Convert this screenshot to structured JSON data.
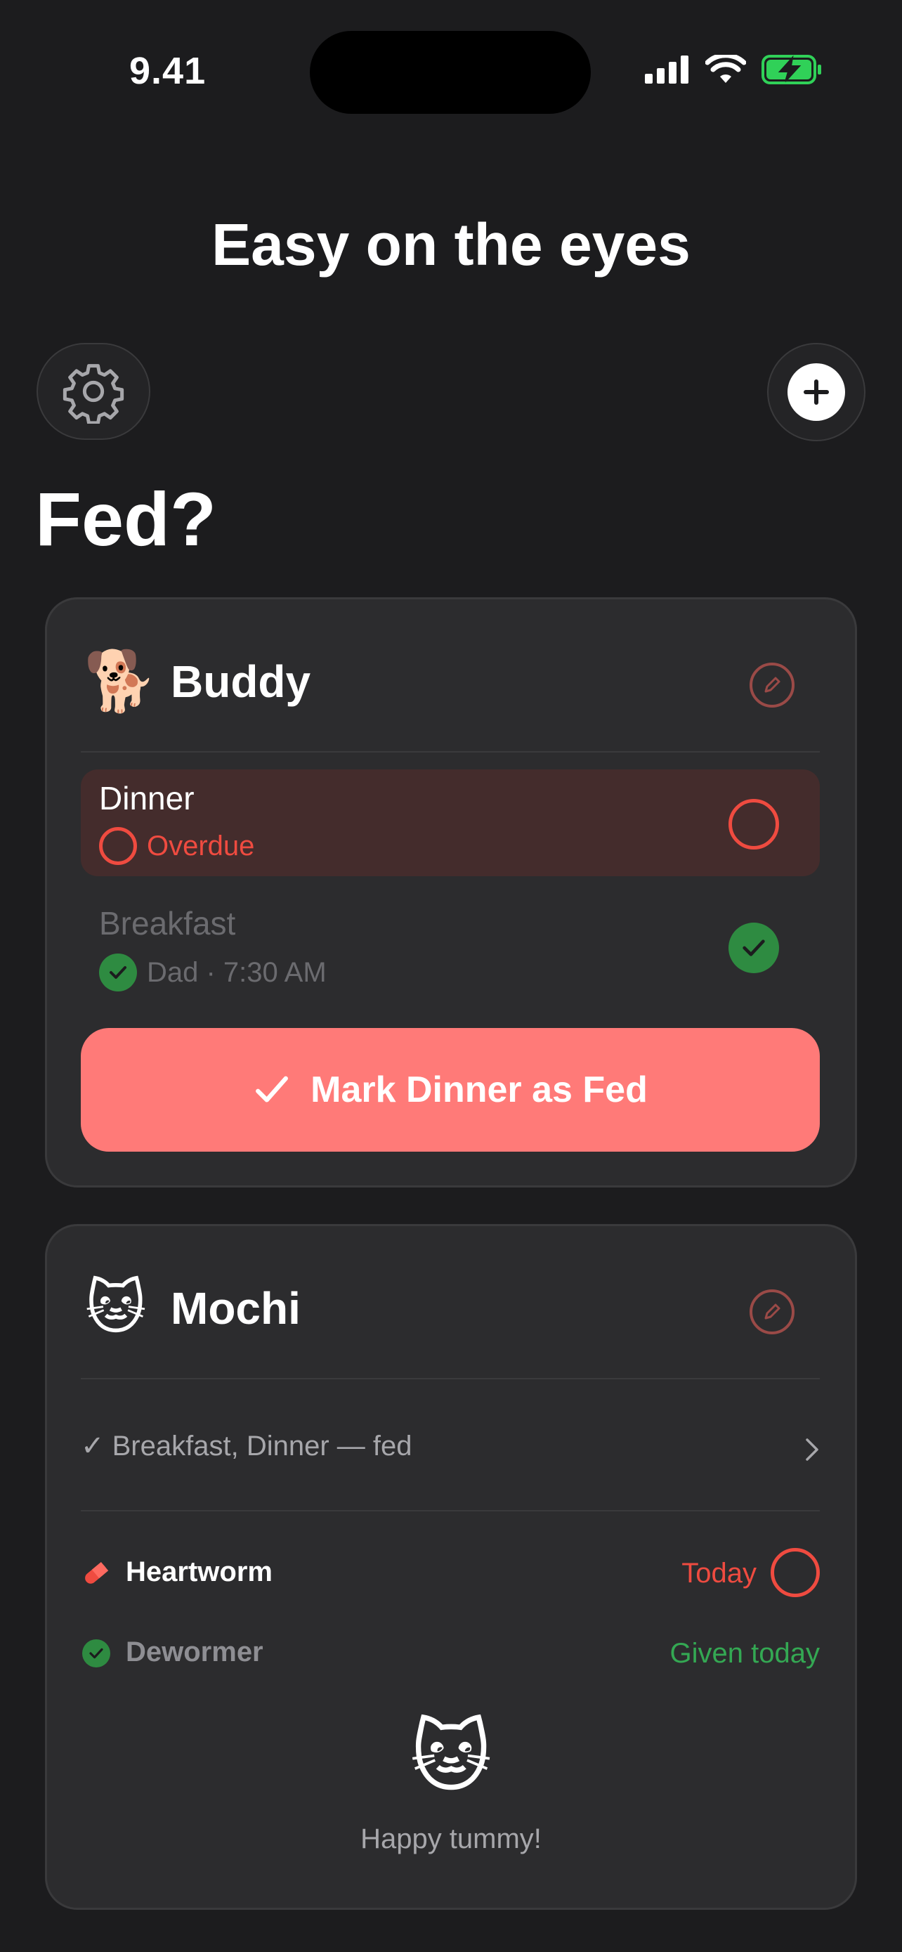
{
  "status": {
    "time": "9.41"
  },
  "hero": {
    "title": "Easy on the eyes"
  },
  "page": {
    "title": "Fed?"
  },
  "pets": [
    {
      "emoji": "🐕",
      "name": "Buddy",
      "meals": [
        {
          "name": "Dinner",
          "status": "Overdue"
        },
        {
          "name": "Breakfast",
          "status": "Dad · 7:30 AM"
        }
      ],
      "cta": "Mark Dinner as Fed"
    },
    {
      "emoji": "🐱",
      "name": "Mochi",
      "summary": "✓ Breakfast, Dinner — fed",
      "meds": [
        {
          "name": "Heartworm",
          "status": "Today"
        },
        {
          "name": "Dewormer",
          "status": "Given today"
        }
      ],
      "footer_emoji": "🐱",
      "footer_text": "Happy tummy!"
    }
  ],
  "colors": {
    "background": "#1c1c1e",
    "card": "#2c2c2e",
    "overdue": "#ef4b40",
    "done": "#2e8b41",
    "cta": "#ff7a78"
  }
}
